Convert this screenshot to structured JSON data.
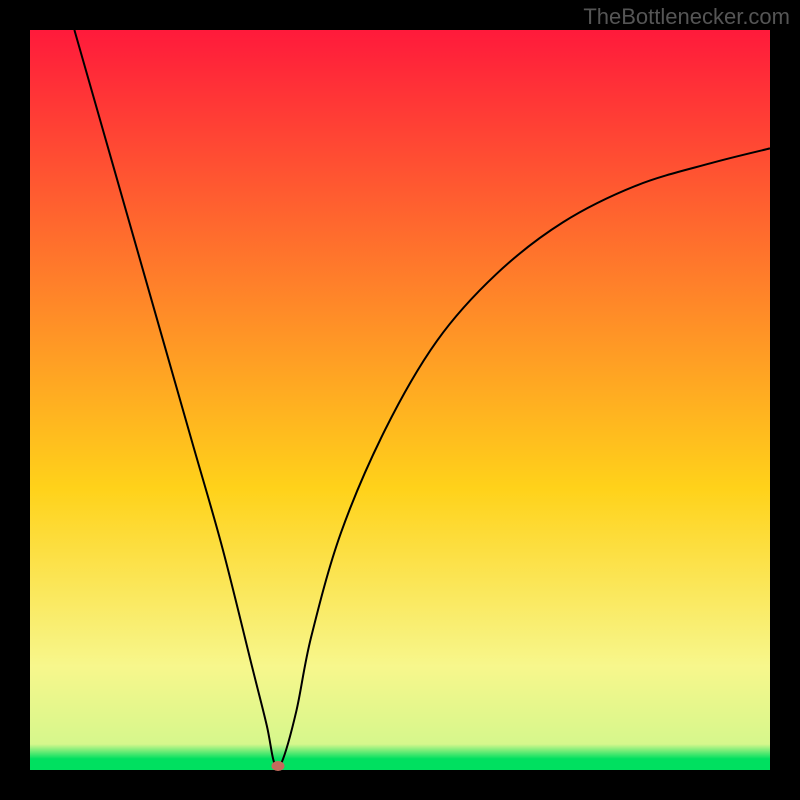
{
  "attribution": "TheBottlenecker.com",
  "chart_data": {
    "type": "line",
    "title": "",
    "xlabel": "",
    "ylabel": "",
    "xlim": [
      0,
      100
    ],
    "ylim": [
      0,
      100
    ],
    "background_gradient": {
      "top": "#ff1a3b",
      "mid_upper": "#ff7f2a",
      "mid": "#ffd21a",
      "mid_lower": "#f7f78c",
      "lower": "#d6f78c",
      "bottom_thin": "#00e060"
    },
    "series": [
      {
        "name": "bottleneck-curve",
        "color": "#000000",
        "x": [
          6,
          10,
          14,
          18,
          22,
          26,
          30,
          32,
          33,
          34,
          36,
          38,
          42,
          48,
          55,
          63,
          72,
          82,
          92,
          100
        ],
        "y": [
          100,
          86,
          72,
          58,
          44,
          30,
          14,
          6,
          1,
          1,
          8,
          18,
          32,
          46,
          58,
          67,
          74,
          79,
          82,
          84
        ]
      }
    ],
    "marker": {
      "x": 33.5,
      "y": 0.5,
      "color": "#c46a5c"
    }
  }
}
